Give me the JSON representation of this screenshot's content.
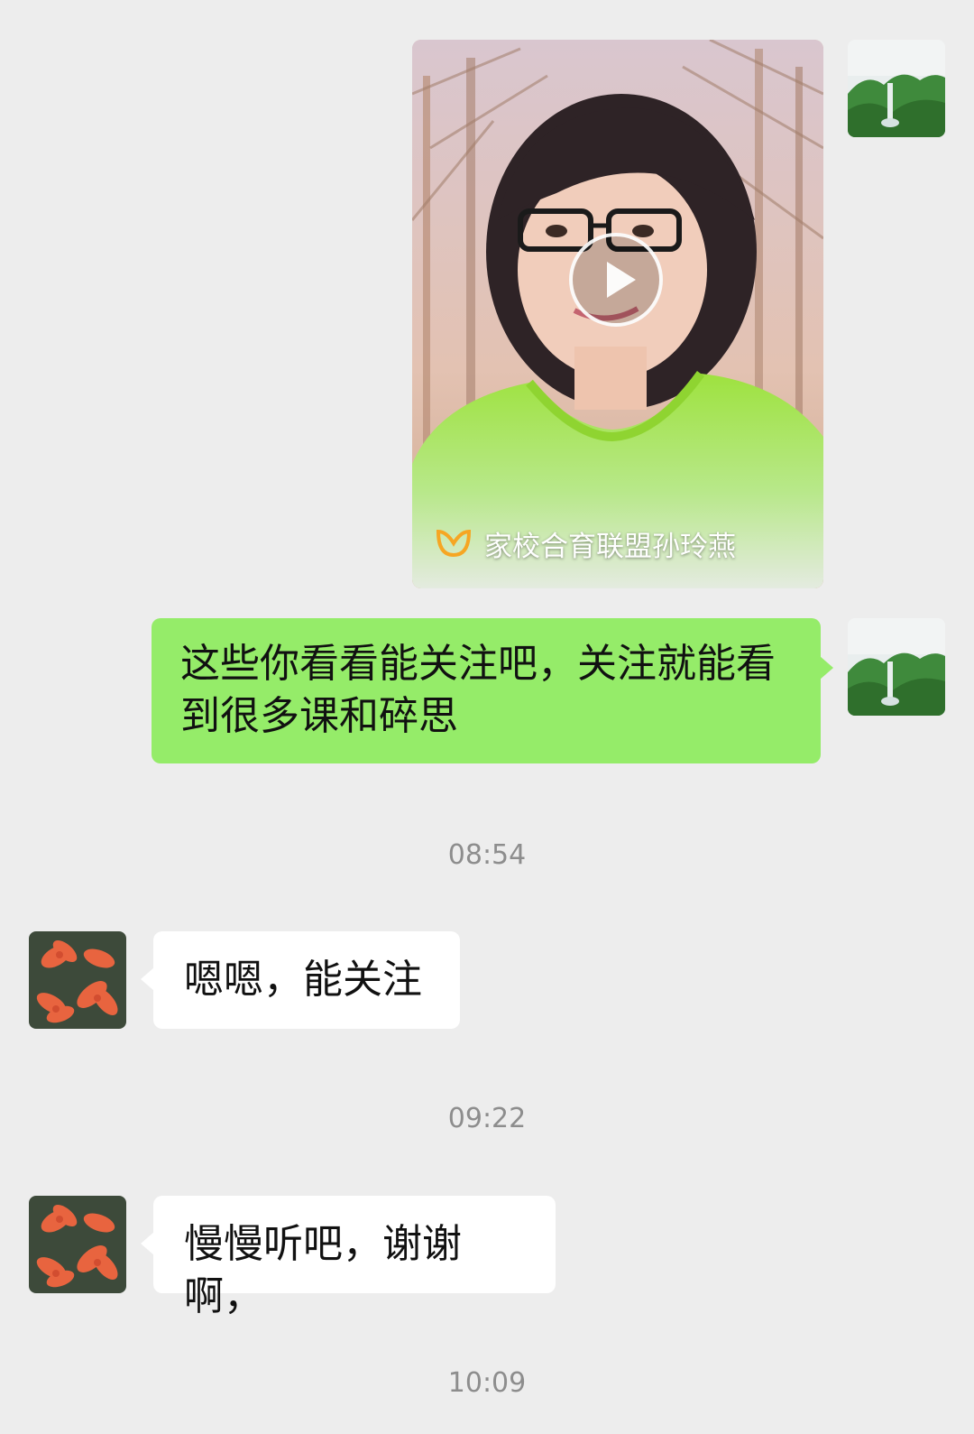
{
  "chat": {
    "messages": [
      {
        "sender": "me",
        "type": "video",
        "source_label": "家校合育联盟孙玲燕",
        "thumbnail": "woman-in-green-sweater-among-trees",
        "icon": "play-icon"
      },
      {
        "sender": "me",
        "type": "text",
        "line1": "这些你看看能关注吧，关注就能看",
        "line2": "到很多课和碎思"
      },
      {
        "type": "timestamp",
        "text": "08:54"
      },
      {
        "sender": "other",
        "type": "text",
        "text": "嗯嗯，能关注"
      },
      {
        "type": "timestamp",
        "text": "09:22"
      },
      {
        "sender": "other",
        "type": "text",
        "text": "慢慢听吧，谢谢啊，"
      },
      {
        "type": "timestamp",
        "text": "10:09"
      }
    ]
  },
  "avatars": {
    "me": "waterfall-mountain-avatar",
    "other": "orange-lily-flowers-avatar"
  },
  "colors": {
    "background": "#ededed",
    "my_bubble": "#95ec69",
    "their_bubble": "#ffffff",
    "timestamp_text": "#8d8d8d"
  }
}
